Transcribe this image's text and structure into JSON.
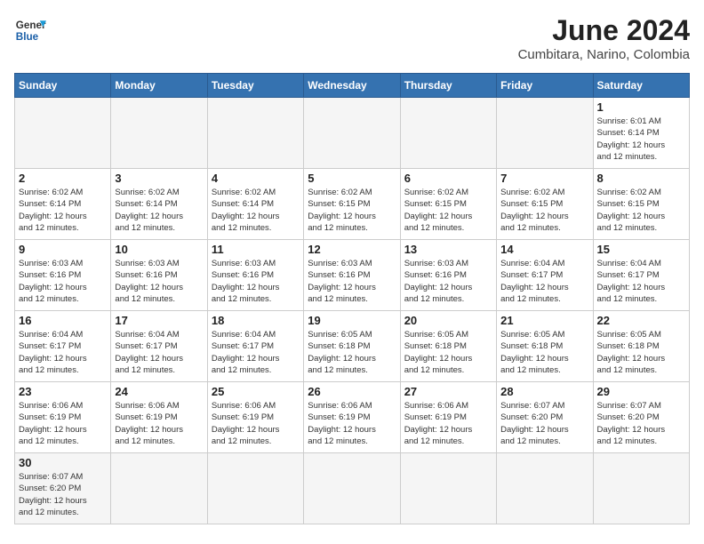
{
  "header": {
    "logo_general": "General",
    "logo_blue": "Blue",
    "title": "June 2024",
    "subtitle": "Cumbitara, Narino, Colombia"
  },
  "weekdays": [
    "Sunday",
    "Monday",
    "Tuesday",
    "Wednesday",
    "Thursday",
    "Friday",
    "Saturday"
  ],
  "weeks": [
    [
      {
        "day": "",
        "info": ""
      },
      {
        "day": "",
        "info": ""
      },
      {
        "day": "",
        "info": ""
      },
      {
        "day": "",
        "info": ""
      },
      {
        "day": "",
        "info": ""
      },
      {
        "day": "",
        "info": ""
      },
      {
        "day": "1",
        "info": "Sunrise: 6:01 AM\nSunset: 6:14 PM\nDaylight: 12 hours\nand 12 minutes."
      }
    ],
    [
      {
        "day": "2",
        "info": "Sunrise: 6:02 AM\nSunset: 6:14 PM\nDaylight: 12 hours\nand 12 minutes."
      },
      {
        "day": "3",
        "info": "Sunrise: 6:02 AM\nSunset: 6:14 PM\nDaylight: 12 hours\nand 12 minutes."
      },
      {
        "day": "4",
        "info": "Sunrise: 6:02 AM\nSunset: 6:14 PM\nDaylight: 12 hours\nand 12 minutes."
      },
      {
        "day": "5",
        "info": "Sunrise: 6:02 AM\nSunset: 6:15 PM\nDaylight: 12 hours\nand 12 minutes."
      },
      {
        "day": "6",
        "info": "Sunrise: 6:02 AM\nSunset: 6:15 PM\nDaylight: 12 hours\nand 12 minutes."
      },
      {
        "day": "7",
        "info": "Sunrise: 6:02 AM\nSunset: 6:15 PM\nDaylight: 12 hours\nand 12 minutes."
      },
      {
        "day": "8",
        "info": "Sunrise: 6:02 AM\nSunset: 6:15 PM\nDaylight: 12 hours\nand 12 minutes."
      }
    ],
    [
      {
        "day": "9",
        "info": "Sunrise: 6:03 AM\nSunset: 6:16 PM\nDaylight: 12 hours\nand 12 minutes."
      },
      {
        "day": "10",
        "info": "Sunrise: 6:03 AM\nSunset: 6:16 PM\nDaylight: 12 hours\nand 12 minutes."
      },
      {
        "day": "11",
        "info": "Sunrise: 6:03 AM\nSunset: 6:16 PM\nDaylight: 12 hours\nand 12 minutes."
      },
      {
        "day": "12",
        "info": "Sunrise: 6:03 AM\nSunset: 6:16 PM\nDaylight: 12 hours\nand 12 minutes."
      },
      {
        "day": "13",
        "info": "Sunrise: 6:03 AM\nSunset: 6:16 PM\nDaylight: 12 hours\nand 12 minutes."
      },
      {
        "day": "14",
        "info": "Sunrise: 6:04 AM\nSunset: 6:17 PM\nDaylight: 12 hours\nand 12 minutes."
      },
      {
        "day": "15",
        "info": "Sunrise: 6:04 AM\nSunset: 6:17 PM\nDaylight: 12 hours\nand 12 minutes."
      }
    ],
    [
      {
        "day": "16",
        "info": "Sunrise: 6:04 AM\nSunset: 6:17 PM\nDaylight: 12 hours\nand 12 minutes."
      },
      {
        "day": "17",
        "info": "Sunrise: 6:04 AM\nSunset: 6:17 PM\nDaylight: 12 hours\nand 12 minutes."
      },
      {
        "day": "18",
        "info": "Sunrise: 6:04 AM\nSunset: 6:17 PM\nDaylight: 12 hours\nand 12 minutes."
      },
      {
        "day": "19",
        "info": "Sunrise: 6:05 AM\nSunset: 6:18 PM\nDaylight: 12 hours\nand 12 minutes."
      },
      {
        "day": "20",
        "info": "Sunrise: 6:05 AM\nSunset: 6:18 PM\nDaylight: 12 hours\nand 12 minutes."
      },
      {
        "day": "21",
        "info": "Sunrise: 6:05 AM\nSunset: 6:18 PM\nDaylight: 12 hours\nand 12 minutes."
      },
      {
        "day": "22",
        "info": "Sunrise: 6:05 AM\nSunset: 6:18 PM\nDaylight: 12 hours\nand 12 minutes."
      }
    ],
    [
      {
        "day": "23",
        "info": "Sunrise: 6:06 AM\nSunset: 6:19 PM\nDaylight: 12 hours\nand 12 minutes."
      },
      {
        "day": "24",
        "info": "Sunrise: 6:06 AM\nSunset: 6:19 PM\nDaylight: 12 hours\nand 12 minutes."
      },
      {
        "day": "25",
        "info": "Sunrise: 6:06 AM\nSunset: 6:19 PM\nDaylight: 12 hours\nand 12 minutes."
      },
      {
        "day": "26",
        "info": "Sunrise: 6:06 AM\nSunset: 6:19 PM\nDaylight: 12 hours\nand 12 minutes."
      },
      {
        "day": "27",
        "info": "Sunrise: 6:06 AM\nSunset: 6:19 PM\nDaylight: 12 hours\nand 12 minutes."
      },
      {
        "day": "28",
        "info": "Sunrise: 6:07 AM\nSunset: 6:20 PM\nDaylight: 12 hours\nand 12 minutes."
      },
      {
        "day": "29",
        "info": "Sunrise: 6:07 AM\nSunset: 6:20 PM\nDaylight: 12 hours\nand 12 minutes."
      }
    ],
    [
      {
        "day": "30",
        "info": "Sunrise: 6:07 AM\nSunset: 6:20 PM\nDaylight: 12 hours\nand 12 minutes."
      },
      {
        "day": "",
        "info": ""
      },
      {
        "day": "",
        "info": ""
      },
      {
        "day": "",
        "info": ""
      },
      {
        "day": "",
        "info": ""
      },
      {
        "day": "",
        "info": ""
      },
      {
        "day": "",
        "info": ""
      }
    ]
  ]
}
